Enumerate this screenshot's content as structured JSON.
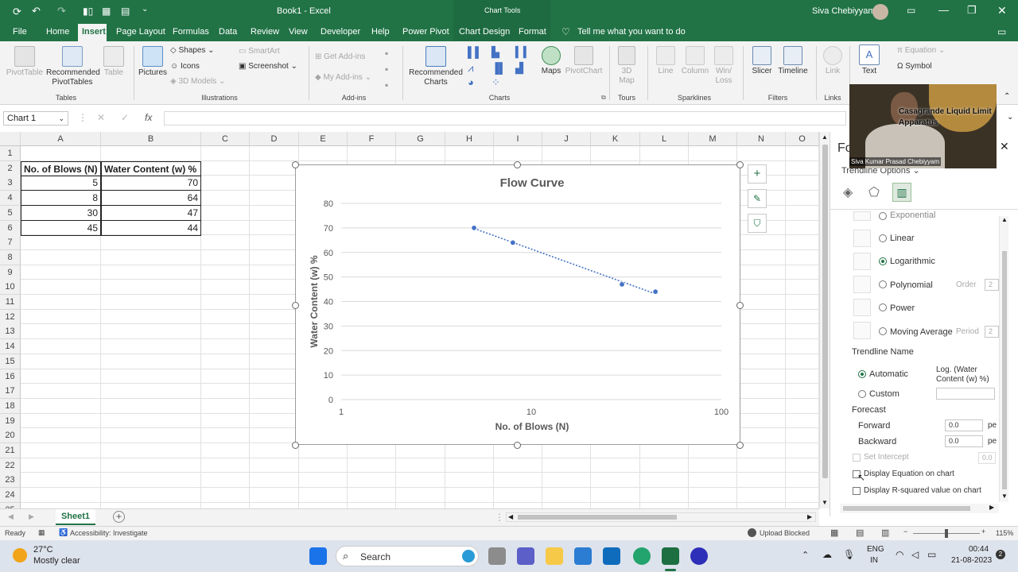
{
  "window": {
    "title": "Book1 - Excel",
    "contextual_group": "Chart Tools",
    "user": "Siva Chebiyyam"
  },
  "menu": {
    "tabs": [
      "File",
      "Home",
      "Insert",
      "Page Layout",
      "Formulas",
      "Data",
      "Review",
      "View",
      "Developer",
      "Help",
      "Power Pivot",
      "Chart Design",
      "Format"
    ],
    "active": "Insert",
    "tell_me": "Tell me what you want to do"
  },
  "ribbon": {
    "tables": {
      "label": "Tables",
      "pivottable": "PivotTable",
      "recommended": "Recommended PivotTables",
      "table": "Table"
    },
    "illustrations": {
      "label": "Illustrations",
      "pictures": "Pictures",
      "shapes": "Shapes",
      "icons": "Icons",
      "models": "3D Models",
      "smartart": "SmartArt",
      "screenshot": "Screenshot"
    },
    "addins": {
      "label": "Add-ins",
      "get": "Get Add-ins",
      "my": "My Add-ins"
    },
    "charts": {
      "label": "Charts",
      "recommended": "Recommended Charts",
      "maps": "Maps",
      "pivotchart": "PivotChart"
    },
    "tours": {
      "label": "Tours",
      "map3d": "3D Map"
    },
    "sparklines": {
      "label": "Sparklines",
      "line": "Line",
      "column": "Column",
      "winloss": "Win/ Loss"
    },
    "filters": {
      "label": "Filters",
      "slicer": "Slicer",
      "timeline": "Timeline"
    },
    "links": {
      "label": "Links",
      "link": "Link"
    },
    "text": {
      "text": "Text",
      "equation": "Equation",
      "symbol": "Symbol"
    }
  },
  "formula_bar": {
    "name_box": "Chart 1",
    "fx": "fx",
    "value": ""
  },
  "sheet": {
    "columns": [
      "A",
      "B",
      "C",
      "D",
      "E",
      "F",
      "G",
      "H",
      "I",
      "J",
      "K",
      "L",
      "M",
      "N",
      "O"
    ],
    "rows": [
      "1",
      "2",
      "3",
      "4",
      "5",
      "6",
      "7",
      "8",
      "9",
      "10",
      "11",
      "12",
      "13",
      "14",
      "15",
      "16",
      "17",
      "18",
      "19",
      "20",
      "21",
      "22",
      "23",
      "24",
      "25"
    ],
    "headers": [
      "No. of Blows (N)",
      "Water Content (w) %"
    ],
    "data": [
      [
        "5",
        "70"
      ],
      [
        "8",
        "64"
      ],
      [
        "30",
        "47"
      ],
      [
        "45",
        "44"
      ]
    ]
  },
  "chart_data": {
    "type": "scatter",
    "title": "Flow Curve",
    "xlabel": "No. of Blows (N)",
    "ylabel": "Water Content (w) %",
    "x_scale": "log",
    "xlim": [
      1,
      100
    ],
    "ylim": [
      0,
      80
    ],
    "x_ticks": [
      "1",
      "10",
      "100"
    ],
    "y_ticks": [
      "0",
      "10",
      "20",
      "30",
      "40",
      "50",
      "60",
      "70",
      "80"
    ],
    "x": [
      5,
      8,
      30,
      45
    ],
    "y": [
      70,
      64,
      47,
      44
    ],
    "trendline": "logarithmic, dotted",
    "grid": "horizontal major gridlines",
    "color": "#4472c4"
  },
  "format_pane": {
    "title": "Fo",
    "section": "Trendline Options",
    "options": [
      "Exponential",
      "Linear",
      "Logarithmic",
      "Polynomial",
      "Power",
      "Moving Average"
    ],
    "selected": "Logarithmic",
    "order_label": "Order",
    "order_value": "2",
    "period_label": "Period",
    "period_value": "2",
    "trendline_name_label": "Trendline Name",
    "automatic": "Automatic",
    "automatic_value": "Log. (Water Content (w) %)",
    "custom": "Custom",
    "forecast": "Forecast",
    "forward": "Forward",
    "forward_value": "0.0",
    "backward": "Backward",
    "backward_value": "0.0",
    "periods_unit": "pe",
    "set_intercept": "Set Intercept",
    "intercept_value": "0.0",
    "display_equation": "Display Equation on chart",
    "display_r2": "Display R-squared value on chart"
  },
  "video": {
    "caption": "Siva Kumar Prasad Chebiyyam",
    "overlay": "Casagrande Liquid Limit Apparatus"
  },
  "sheet_tabs": {
    "active": "Sheet1"
  },
  "status": {
    "ready": "Ready",
    "accessibility": "Accessibility: Investigate",
    "upload": "Upload Blocked",
    "zoom": "115%"
  },
  "taskbar": {
    "weather_temp": "27°C",
    "weather_desc": "Mostly clear",
    "search": "Search",
    "lang1": "ENG",
    "lang2": "IN",
    "time": "00:44",
    "date": "21-08-2023"
  },
  "colors": {
    "excel_green": "#217346",
    "series": "#4472c4"
  }
}
